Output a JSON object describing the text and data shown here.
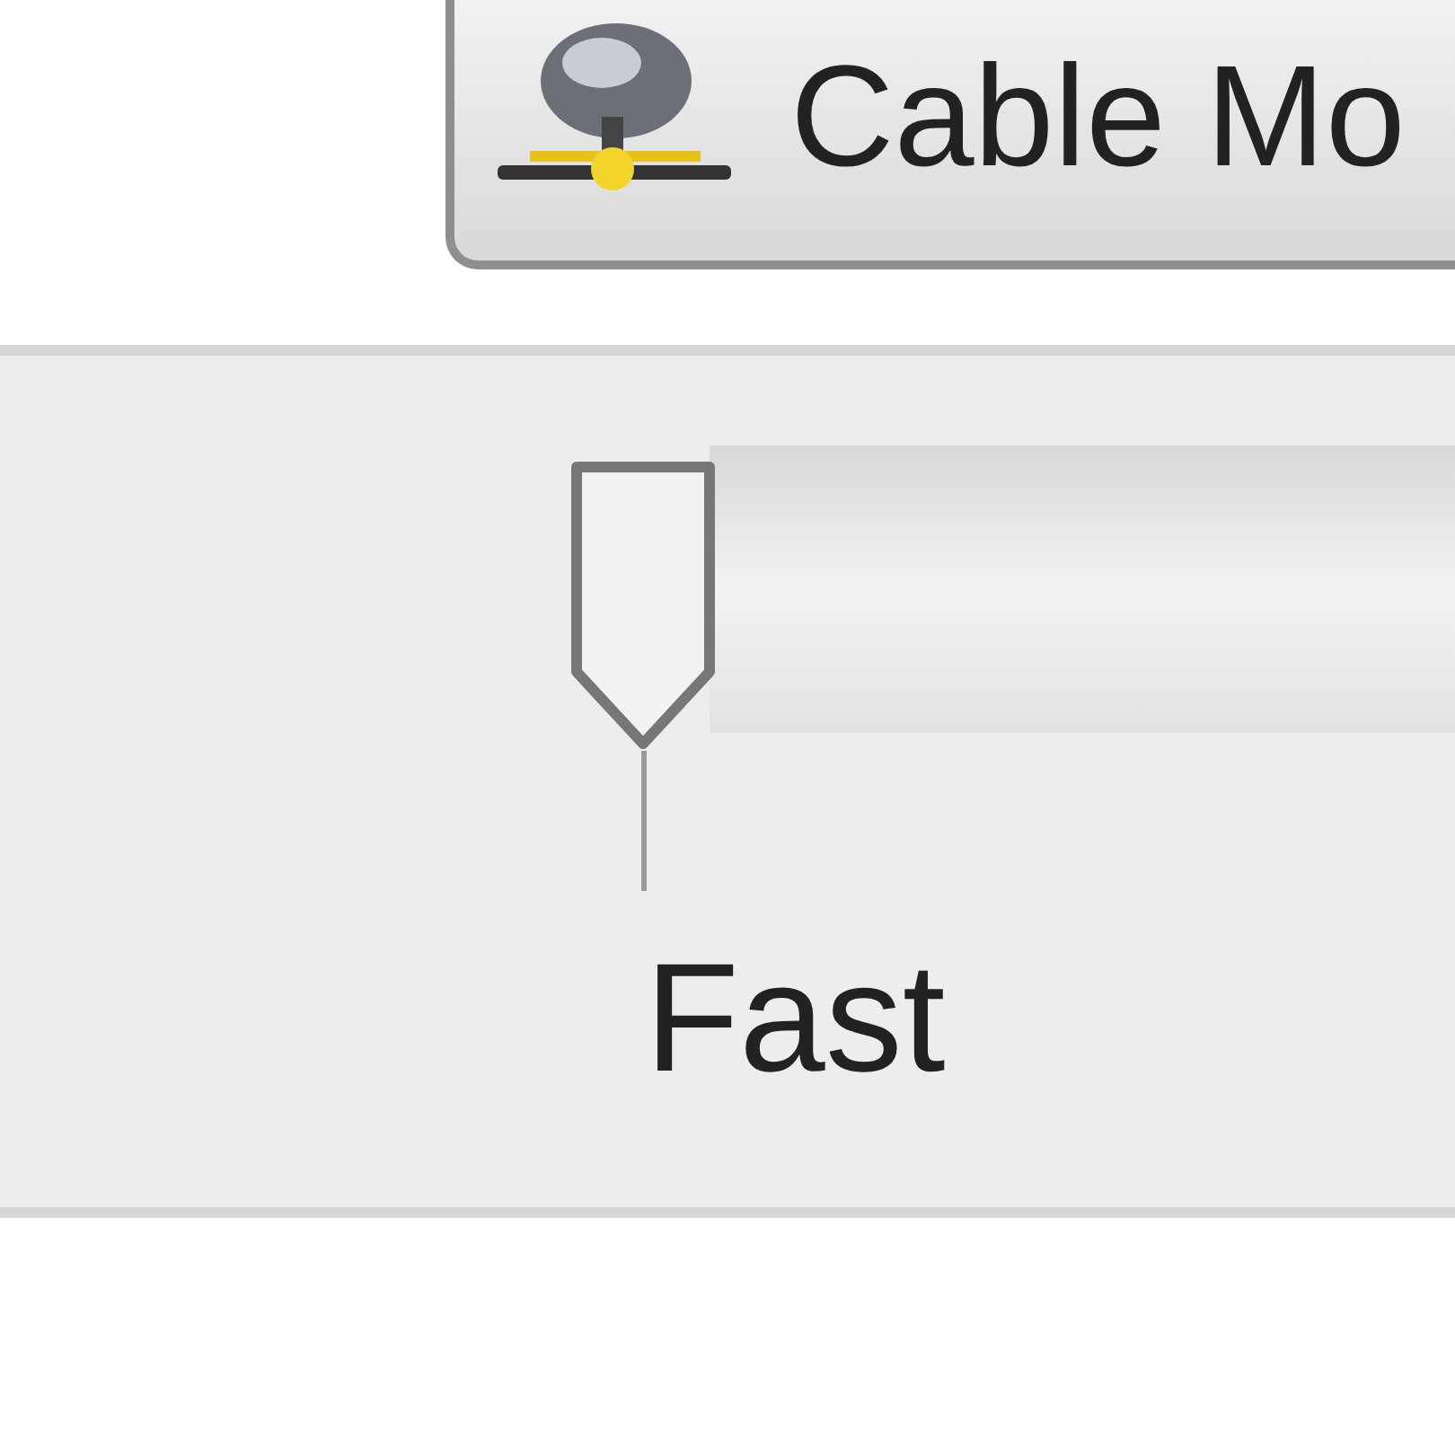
{
  "button": {
    "label": "Cable Mo"
  },
  "slider": {
    "level": 0,
    "tick_label": "Fast"
  }
}
